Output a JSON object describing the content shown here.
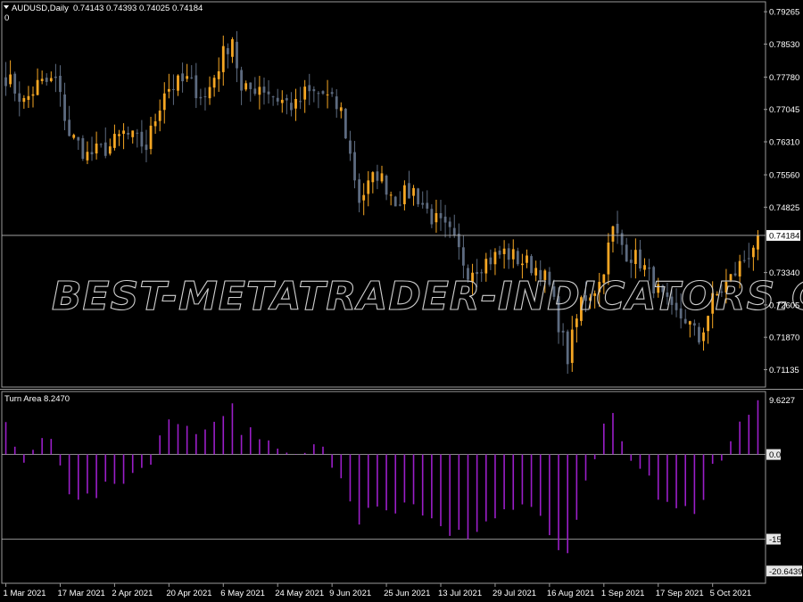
{
  "header": {
    "symbol": "AUDUSD,Daily",
    "ohlc": "0.74143 0.74393 0.74025 0.74184",
    "sub_label": "0"
  },
  "indicator": {
    "label": "Turn Area 8.2470"
  },
  "watermark": "BEST-METATRADER-INDICATORS.COM",
  "colors": {
    "background": "#000000",
    "bull": "#f5a623",
    "bear": "#5d6b80",
    "histogram": "#9b1ec9",
    "grid_line": "#b8b8b8",
    "text": "#ffffff"
  },
  "chart_data": [
    {
      "type": "candlestick",
      "title": "AUDUSD,Daily",
      "ylim": [
        0.7078,
        0.7945
      ],
      "y_ticks": [
        "0.79265",
        "0.78530",
        "0.77780",
        "0.77045",
        "0.76310",
        "0.75560",
        "0.74825",
        "0.74184",
        "0.73340",
        "0.72605",
        "0.71870",
        "0.71135"
      ],
      "current_price": "0.74184",
      "current_price_value": 0.74184,
      "x_ticks": [
        "1 Mar 2021",
        "17 Mar 2021",
        "2 Apr 2021",
        "20 Apr 2021",
        "6 May 2021",
        "24 May 2021",
        "9 Jun 2021",
        "25 Jun 2021",
        "13 Jul 2021",
        "29 Jul 2021",
        "16 Aug 2021",
        "1 Sep 2021",
        "17 Sep 2021",
        "5 Oct 2021"
      ],
      "close_path": [
        {
          "d": "2021-03-01",
          "c": 0.778
        },
        {
          "d": "2021-03-05",
          "c": 0.772
        },
        {
          "d": "2021-03-10",
          "c": 0.776
        },
        {
          "d": "2021-03-16",
          "c": 0.777
        },
        {
          "d": "2021-03-19",
          "c": 0.765
        },
        {
          "d": "2021-03-25",
          "c": 0.76
        },
        {
          "d": "2021-04-01",
          "c": 0.762
        },
        {
          "d": "2021-04-06",
          "c": 0.765
        },
        {
          "d": "2021-04-13",
          "c": 0.762
        },
        {
          "d": "2021-04-19",
          "c": 0.775
        },
        {
          "d": "2021-04-26",
          "c": 0.777
        },
        {
          "d": "2021-04-30",
          "c": 0.773
        },
        {
          "d": "2021-05-06",
          "c": 0.783
        },
        {
          "d": "2021-05-10",
          "c": 0.787
        },
        {
          "d": "2021-05-12",
          "c": 0.774
        },
        {
          "d": "2021-05-18",
          "c": 0.776
        },
        {
          "d": "2021-05-24",
          "c": 0.773
        },
        {
          "d": "2021-05-28",
          "c": 0.771
        },
        {
          "d": "2021-06-01",
          "c": 0.774
        },
        {
          "d": "2021-06-07",
          "c": 0.774
        },
        {
          "d": "2021-06-11",
          "c": 0.77
        },
        {
          "d": "2021-06-17",
          "c": 0.75
        },
        {
          "d": "2021-06-23",
          "c": 0.756
        },
        {
          "d": "2021-06-29",
          "c": 0.75
        },
        {
          "d": "2021-07-05",
          "c": 0.752
        },
        {
          "d": "2021-07-09",
          "c": 0.746
        },
        {
          "d": "2021-07-15",
          "c": 0.742
        },
        {
          "d": "2021-07-21",
          "c": 0.734
        },
        {
          "d": "2021-07-27",
          "c": 0.736
        },
        {
          "d": "2021-08-02",
          "c": 0.738
        },
        {
          "d": "2021-08-06",
          "c": 0.736
        },
        {
          "d": "2021-08-12",
          "c": 0.734
        },
        {
          "d": "2021-08-16",
          "c": 0.73
        },
        {
          "d": "2021-08-20",
          "c": 0.714
        },
        {
          "d": "2021-08-25",
          "c": 0.727
        },
        {
          "d": "2021-08-31",
          "c": 0.731
        },
        {
          "d": "2021-09-03",
          "c": 0.743
        },
        {
          "d": "2021-09-08",
          "c": 0.738
        },
        {
          "d": "2021-09-13",
          "c": 0.736
        },
        {
          "d": "2021-09-17",
          "c": 0.729
        },
        {
          "d": "2021-09-22",
          "c": 0.724
        },
        {
          "d": "2021-09-27",
          "c": 0.723
        },
        {
          "d": "2021-09-30",
          "c": 0.718
        },
        {
          "d": "2021-10-05",
          "c": 0.727
        },
        {
          "d": "2021-10-11",
          "c": 0.732
        },
        {
          "d": "2021-10-15",
          "c": 0.738
        },
        {
          "d": "2021-10-19",
          "c": 0.7418
        }
      ]
    },
    {
      "type": "bar",
      "title": "Turn Area 8.2470",
      "ylim": [
        -22.5,
        11
      ],
      "y_ticks": [
        "9.6227",
        "0.00",
        "-15",
        "-20.6439"
      ],
      "levels": [
        0,
        -15
      ],
      "level_labels": [
        "0.00",
        "-15"
      ],
      "max_label": "9.6227",
      "min_label": "-20.6439",
      "profile": [
        {
          "d": "2021-03-01",
          "v": 6
        },
        {
          "d": "2021-03-05",
          "v": -3
        },
        {
          "d": "2021-03-10",
          "v": 3
        },
        {
          "d": "2021-03-16",
          "v": 2
        },
        {
          "d": "2021-03-19",
          "v": -6
        },
        {
          "d": "2021-03-25",
          "v": -8
        },
        {
          "d": "2021-04-01",
          "v": -6
        },
        {
          "d": "2021-04-06",
          "v": -4
        },
        {
          "d": "2021-04-13",
          "v": -2
        },
        {
          "d": "2021-04-19",
          "v": 5
        },
        {
          "d": "2021-04-26",
          "v": 6
        },
        {
          "d": "2021-04-30",
          "v": 4
        },
        {
          "d": "2021-05-06",
          "v": 8
        },
        {
          "d": "2021-05-10",
          "v": 8
        },
        {
          "d": "2021-05-12",
          "v": 5
        },
        {
          "d": "2021-05-18",
          "v": 2
        },
        {
          "d": "2021-05-24",
          "v": 0.5
        },
        {
          "d": "2021-05-28",
          "v": -1
        },
        {
          "d": "2021-06-01",
          "v": 1
        },
        {
          "d": "2021-06-07",
          "v": 1.5
        },
        {
          "d": "2021-06-11",
          "v": -3
        },
        {
          "d": "2021-06-17",
          "v": -11
        },
        {
          "d": "2021-06-23",
          "v": -8
        },
        {
          "d": "2021-06-29",
          "v": -10
        },
        {
          "d": "2021-07-05",
          "v": -8
        },
        {
          "d": "2021-07-09",
          "v": -12
        },
        {
          "d": "2021-07-15",
          "v": -15
        },
        {
          "d": "2021-07-21",
          "v": -14
        },
        {
          "d": "2021-07-27",
          "v": -12
        },
        {
          "d": "2021-08-02",
          "v": -10
        },
        {
          "d": "2021-08-06",
          "v": -9
        },
        {
          "d": "2021-08-12",
          "v": -12
        },
        {
          "d": "2021-08-16",
          "v": -14
        },
        {
          "d": "2021-08-20",
          "v": -19
        },
        {
          "d": "2021-08-25",
          "v": -9
        },
        {
          "d": "2021-08-31",
          "v": 3
        },
        {
          "d": "2021-09-03",
          "v": 6
        },
        {
          "d": "2021-09-08",
          "v": -0.5
        },
        {
          "d": "2021-09-13",
          "v": -3
        },
        {
          "d": "2021-09-17",
          "v": -7
        },
        {
          "d": "2021-09-22",
          "v": -9
        },
        {
          "d": "2021-09-27",
          "v": -10
        },
        {
          "d": "2021-09-30",
          "v": -12
        },
        {
          "d": "2021-10-05",
          "v": -2
        },
        {
          "d": "2021-10-11",
          "v": 3
        },
        {
          "d": "2021-10-15",
          "v": 7
        },
        {
          "d": "2021-10-19",
          "v": 8.5
        }
      ]
    }
  ]
}
